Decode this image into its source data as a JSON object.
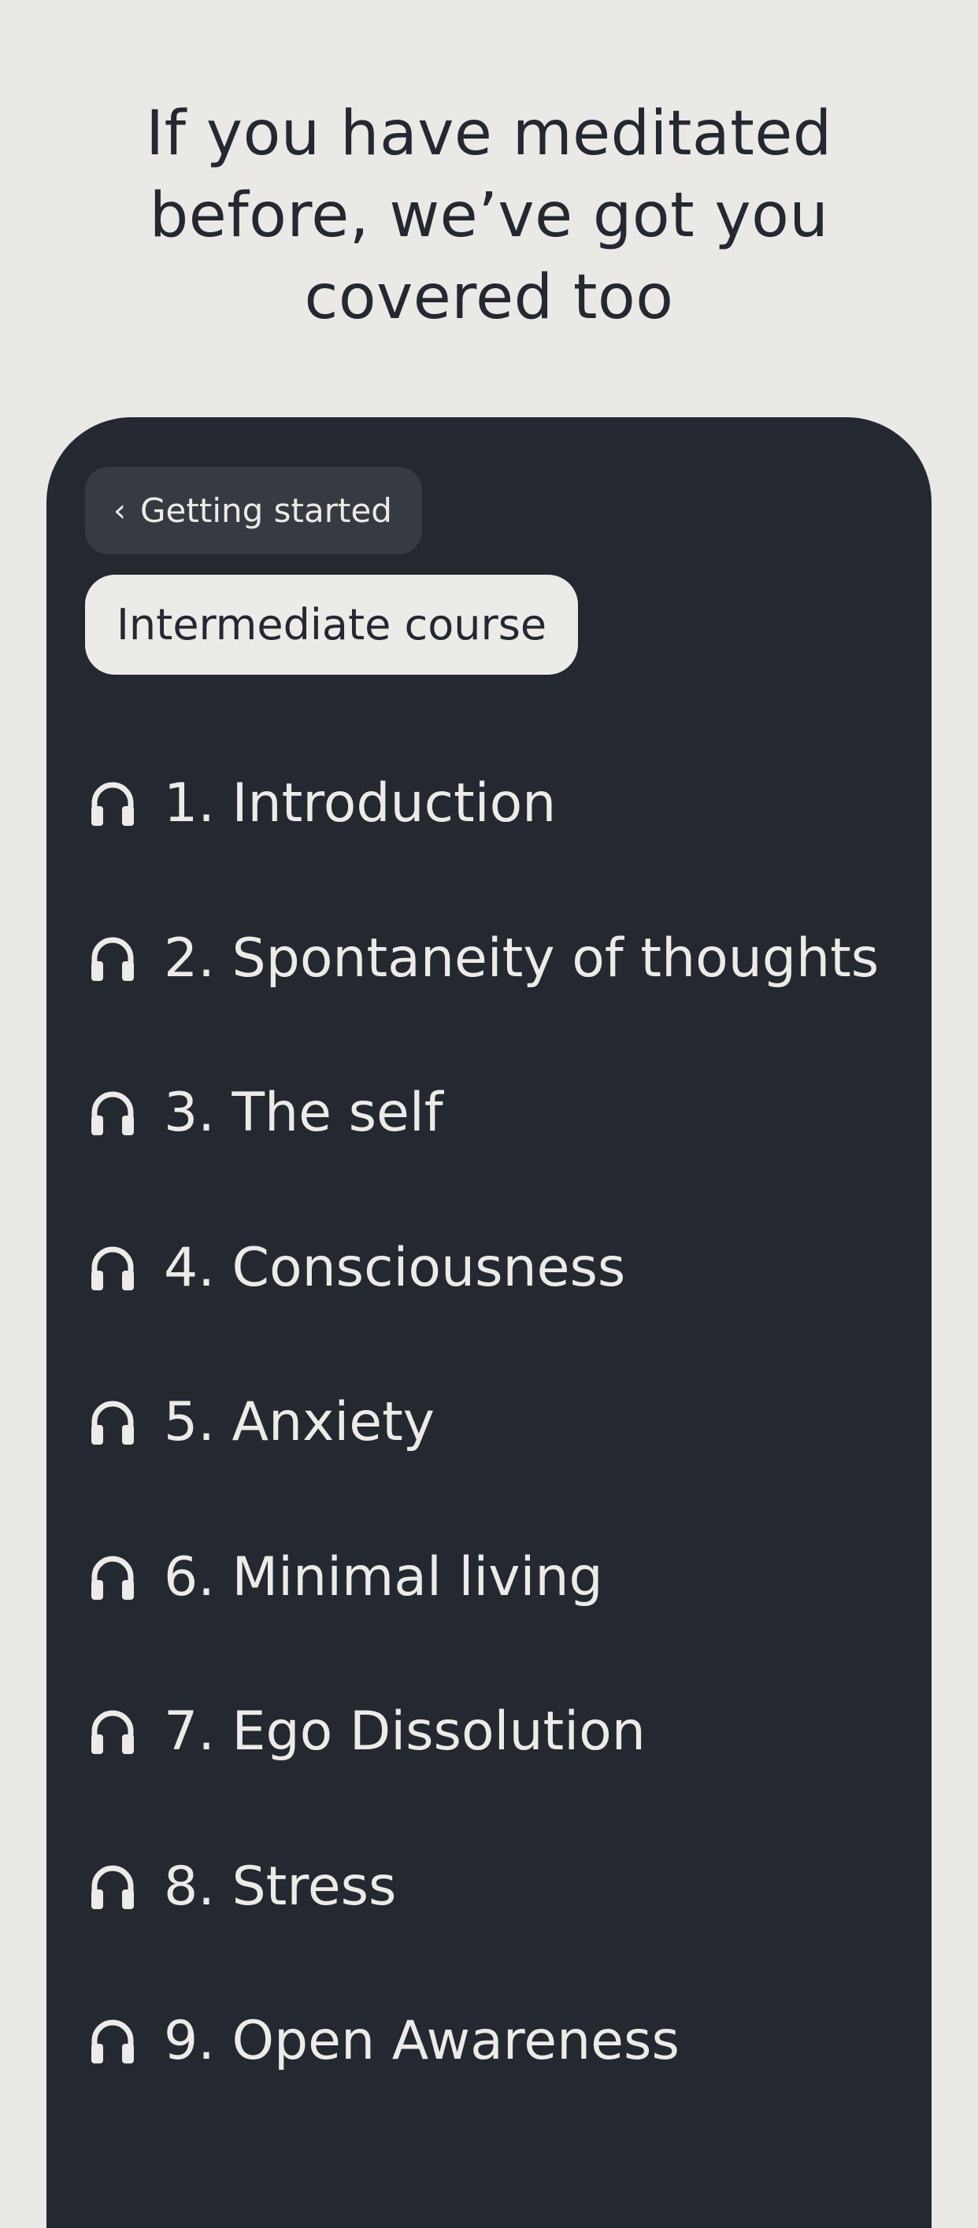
{
  "header": {
    "title": "If you have meditated before, we’ve got you covered too"
  },
  "course": {
    "back_label": "Getting started",
    "back_icon": "chevron-left-icon",
    "current_label": "Intermediate course",
    "lesson_icon": "headphones-icon",
    "lessons": [
      {
        "label": "1. Introduction"
      },
      {
        "label": "2. Spontaneity of thoughts"
      },
      {
        "label": "3. The self"
      },
      {
        "label": "4. Consciousness"
      },
      {
        "label": "5. Anxiety"
      },
      {
        "label": "6. Minimal living"
      },
      {
        "label": "7. Ego Dissolution"
      },
      {
        "label": "8. Stress"
      },
      {
        "label": "9. Open Awareness"
      }
    ]
  },
  "colors": {
    "background": "#EAE9E6",
    "panel": "#232831",
    "text_light": "#ECEBE8",
    "text_dark": "#232831",
    "back_button": "#363B43"
  }
}
